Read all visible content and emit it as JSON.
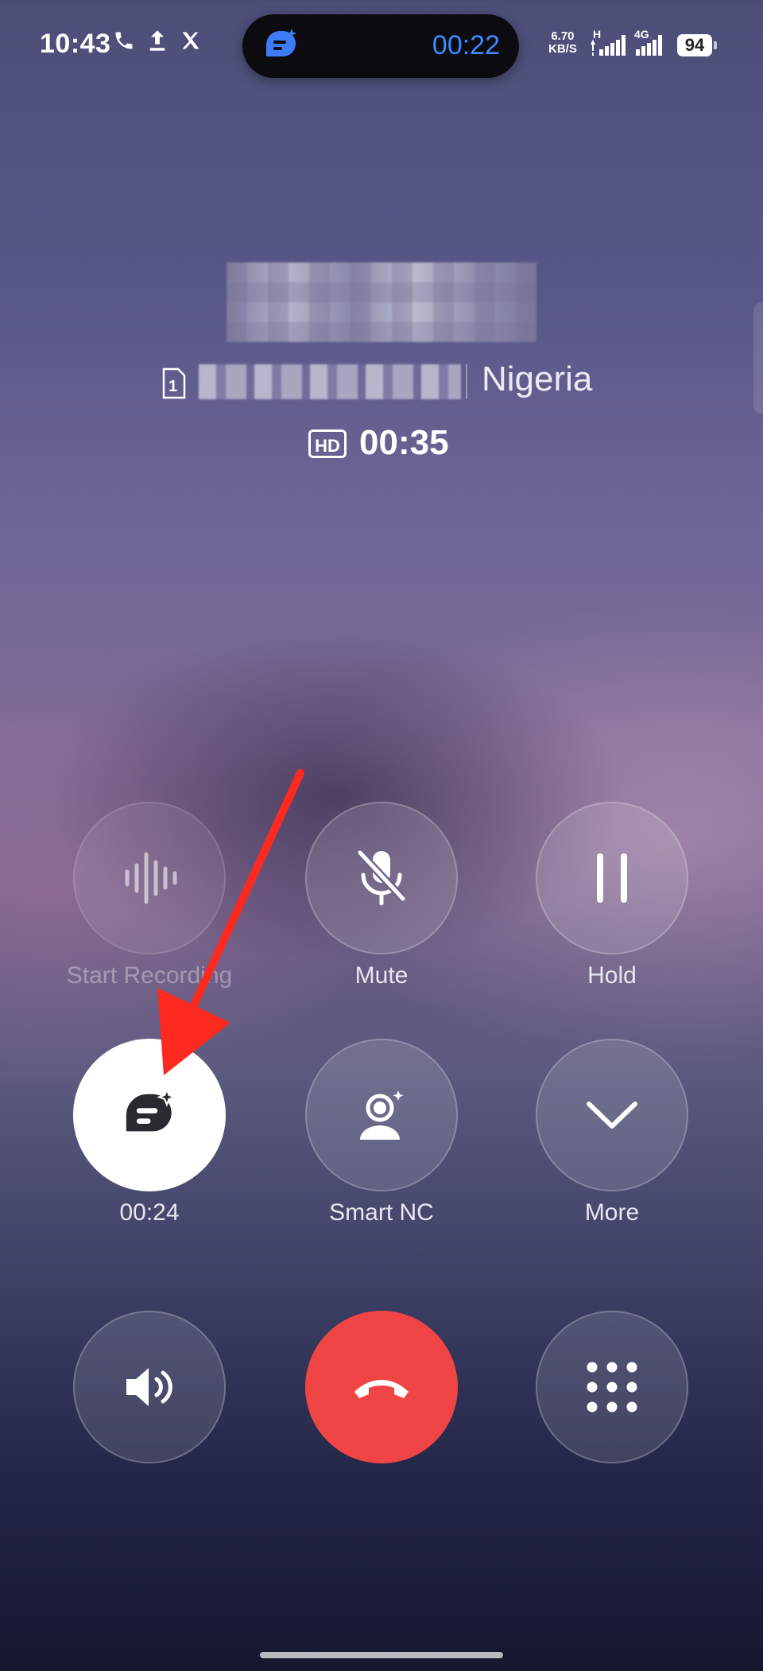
{
  "status_bar": {
    "time": "10:43",
    "net_speed_value": "6.70",
    "net_speed_unit": "KB/S",
    "signal_1_label": "H",
    "signal_2_label": "4G",
    "battery": "94"
  },
  "pill": {
    "icon": "ai-chat-icon",
    "timer": "00:22"
  },
  "caller": {
    "sim": "1",
    "location": "Nigeria",
    "hd": "HD",
    "duration": "00:35"
  },
  "controls": {
    "record": {
      "label": "Start Recording",
      "icon": "waveform-icon"
    },
    "mute": {
      "label": "Mute",
      "icon": "mic-off-icon"
    },
    "hold": {
      "label": "Hold",
      "icon": "pause-icon"
    },
    "ai_summary": {
      "label": "00:24",
      "icon": "ai-chat-icon"
    },
    "smart_nc": {
      "label": "Smart NC",
      "icon": "smart-nc-icon"
    },
    "more": {
      "label": "More",
      "icon": "chevron-down-icon"
    }
  },
  "bottom": {
    "speaker_icon": "speaker-icon",
    "end_call_icon": "end-call-icon",
    "keypad_icon": "keypad-icon"
  },
  "colors": {
    "end_call": "#f04545",
    "pill_timer": "#3d8bff",
    "annotation_arrow": "#ff2a1f"
  }
}
